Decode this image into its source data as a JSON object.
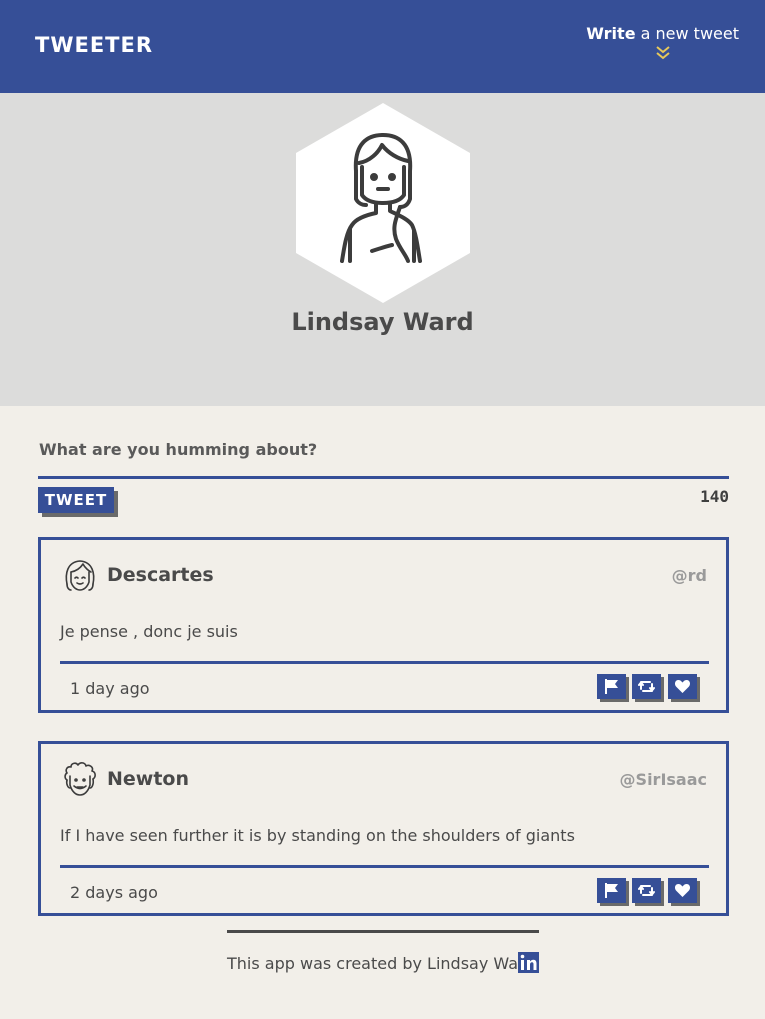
{
  "header": {
    "brand": "TWEETER",
    "compose_strong": "Write",
    "compose_rest": " a new tweet",
    "compose_icon": "double-chevron-down-icon"
  },
  "profile": {
    "name": "Lindsay Ward",
    "avatar_icon": "woman-avatar-icon"
  },
  "composer": {
    "label": "What are you humming about?",
    "value": "",
    "button_label": "TWEET",
    "counter": "140"
  },
  "tweets": [
    {
      "author": "Descartes",
      "handle": "@rd",
      "text": "Je pense , donc je suis",
      "time": "1 day ago",
      "avatar_icon": "girl-face-avatar-icon"
    },
    {
      "author": "Newton",
      "handle": "@SirIsaac",
      "text": "If I have seen further it is by standing on the shoulders of giants",
      "time": "2 days ago",
      "avatar_icon": "curly-hair-avatar-icon"
    }
  ],
  "footer": {
    "text": "This app was created by Lindsay Ward",
    "link_icon": "linkedin-icon"
  },
  "colors": {
    "accent": "#364f97",
    "page_background": "#f2efe9",
    "profile_background": "#dcdcdb",
    "text": "#4a4a4a",
    "handle": "#9a9a9a",
    "shadow": "#6a6a6a"
  }
}
